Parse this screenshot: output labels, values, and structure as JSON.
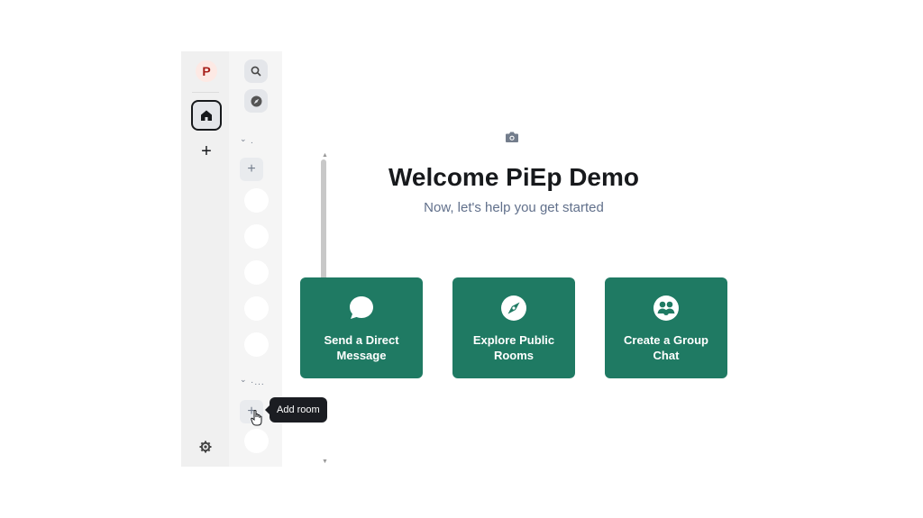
{
  "spacebar": {
    "avatar_letter": "P",
    "icons": {
      "home": "home-icon",
      "add": "plus-icon",
      "settings": "gear-icon"
    },
    "add_symbol": "+"
  },
  "roomlist": {
    "icons": {
      "search": "search-icon",
      "explore": "compass-icon"
    },
    "sections": [
      {
        "chevron": "⌄",
        "label": "."
      },
      {
        "chevron": "⌄",
        "label": "·..."
      }
    ],
    "add_symbol": "+"
  },
  "tooltip": {
    "text": "Add room"
  },
  "welcome": {
    "title": "Welcome PiEp Demo",
    "subtitle": "Now, let's help you get started"
  },
  "cards": [
    {
      "label": "Send a Direct Message",
      "icon": "chat-bubble-icon"
    },
    {
      "label": "Explore Public Rooms",
      "icon": "compass-icon"
    },
    {
      "label": "Create a Group Chat",
      "icon": "group-icon"
    }
  ],
  "colors": {
    "accent": "#1f7a63",
    "avatar_bg": "#fde9e4",
    "avatar_fg": "#a8201a",
    "subtitle": "#61708b"
  }
}
